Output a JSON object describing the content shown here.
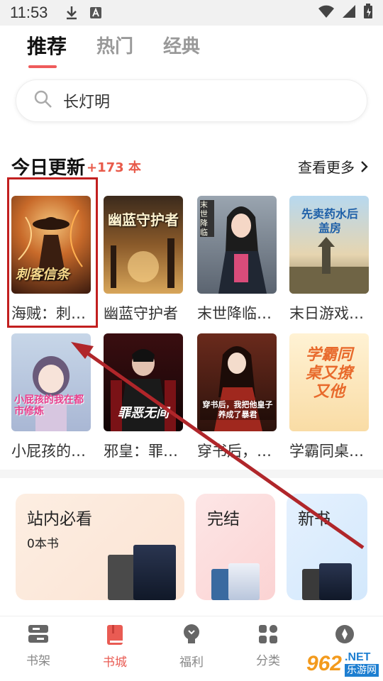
{
  "status_bar": {
    "time": "11:53"
  },
  "tabs": [
    {
      "label": "推荐",
      "active": true
    },
    {
      "label": "热门",
      "active": false
    },
    {
      "label": "经典",
      "active": false
    }
  ],
  "search": {
    "value": "长灯明"
  },
  "today": {
    "title": "今日更新",
    "count": "+173 本",
    "more_label": "查看更多",
    "books": [
      {
        "title": "海贼：刺…",
        "cover_text": "刺客信条"
      },
      {
        "title": "幽蓝守护者",
        "cover_text": "幽蓝守护者"
      },
      {
        "title": "末世降临…",
        "cover_text": "末世降临"
      },
      {
        "title": "末日游戏…",
        "cover_text": "先卖药水后盖房"
      },
      {
        "title": "小屁孩的…",
        "cover_text": "小屁孩的我在都市修炼"
      },
      {
        "title": "邪皇：罪…",
        "cover_text": "罪恶无间"
      },
      {
        "title": "穿书后，…",
        "cover_text": "穿书后，我把他皇子养成了暴君"
      },
      {
        "title": "学霸同桌…",
        "cover_text": "学霸同桌又撩又他"
      }
    ]
  },
  "categories": [
    {
      "title": "站内必看",
      "subtitle": "0本书",
      "color": "#fbe9dd"
    },
    {
      "title": "完结",
      "color": "#fde1e1"
    },
    {
      "title": "新书",
      "color": "#ddefff"
    }
  ],
  "nav": [
    {
      "label": "书架",
      "icon": "bookshelf-icon",
      "active": false
    },
    {
      "label": "书城",
      "icon": "book-icon",
      "active": true
    },
    {
      "label": "福利",
      "icon": "lightbulb-icon",
      "active": false
    },
    {
      "label": "分类",
      "icon": "grid-icon",
      "active": false
    },
    {
      "label": "",
      "icon": "compass-icon",
      "active": false
    }
  ],
  "watermark": {
    "brand": "962",
    "suffix": ".NET",
    "sub": "乐游网"
  }
}
